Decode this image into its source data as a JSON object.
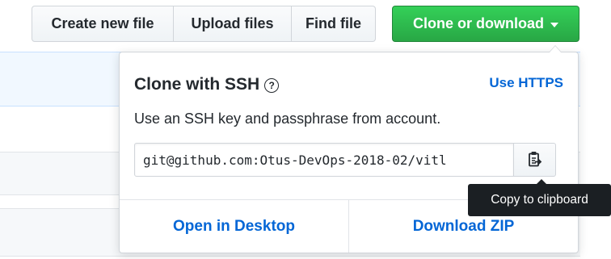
{
  "toolbar": {
    "create_label": "Create new file",
    "upload_label": "Upload files",
    "find_label": "Find file",
    "clone_label": "Clone or download"
  },
  "clone_panel": {
    "title": "Clone with SSH",
    "help_glyph": "?",
    "switch_label": "Use HTTPS",
    "description": "Use an SSH key and passphrase from account.",
    "url_value": "git@github.com:Otus-DevOps-2018-02/vitl",
    "copy_icon": "clipboard-icon",
    "open_desktop_label": "Open in Desktop",
    "download_zip_label": "Download ZIP"
  },
  "tooltip": {
    "text": "Copy to clipboard"
  },
  "colors": {
    "primary": "#28a745",
    "link": "#0366d6",
    "tooltip_bg": "#1b1f23"
  }
}
